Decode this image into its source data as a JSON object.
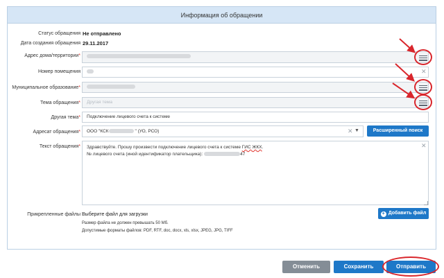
{
  "panel": {
    "title": "Информация об обращении"
  },
  "form": {
    "status": {
      "label": "Статус обращения",
      "value": "Не отправлено"
    },
    "created": {
      "label": "Дата создания обращения",
      "value": "29.11.2017"
    },
    "address": {
      "label": "Адрес дома/территории"
    },
    "room": {
      "label": "Номер помещения"
    },
    "municipality": {
      "label": "Муниципальное образование"
    },
    "topic": {
      "label": "Тема обращения",
      "placeholder": "Другая тема"
    },
    "other_topic": {
      "label": "Другая тема",
      "value": "Подключение лицевого счета к системе"
    },
    "recipient": {
      "label": "Адресат обращения",
      "value_prefix": "ООО \"КСК",
      "value_suffix": "\" (УО, РСО)",
      "search_button": "Расширенный поиск"
    },
    "text": {
      "label": "Текст обращения",
      "line1_prefix": "Здравствуйте. Прошу произвести подключение лицевого счета к системе ",
      "line1_spell": "ГИС ЖКХ",
      "line1_end": ".",
      "line2_prefix": "№ лицевого счета (иной идентификатор плательщика): ",
      "line2_suffix": "47"
    },
    "files": {
      "label": "Прикрепленные файлы",
      "choose": "Выберите файл для загрузки",
      "limit": "Размер файла не должен превышать 50 Мб.",
      "formats": "Допустимые форматы файлов: PDF, RTF, doc, docx, xls, xlsx, JPEG, JPG, TIFF",
      "add_button": "Добавить файл"
    }
  },
  "footer": {
    "cancel": "Отменить",
    "save": "Сохранить",
    "send": "Отправить"
  },
  "required_mark": "*",
  "colors": {
    "accent": "#1e78c8",
    "annotation": "#d9262c",
    "header_bg": "#d6e6f6"
  }
}
